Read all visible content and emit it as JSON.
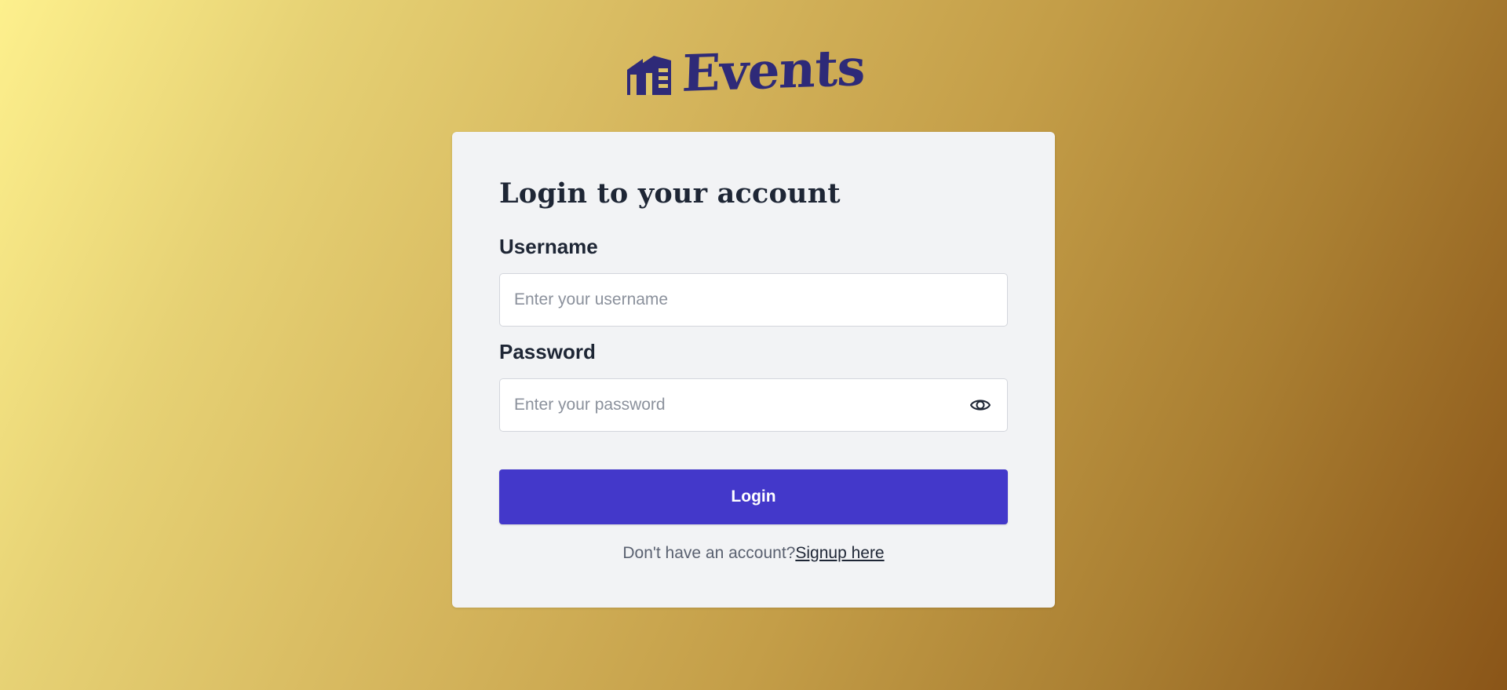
{
  "brand": {
    "name": "Events",
    "icon": "house-icon",
    "color": "#2e2a78"
  },
  "login_form": {
    "title": "Login to your account",
    "username": {
      "label": "Username",
      "placeholder": "Enter your username",
      "value": ""
    },
    "password": {
      "label": "Password",
      "placeholder": "Enter your password",
      "value": "",
      "toggle_icon": "eye-icon"
    },
    "submit_label": "Login",
    "signup_prompt": "Don't have an account?",
    "signup_link": "Signup here"
  },
  "colors": {
    "accent": "#4338ca",
    "card_background": "#f2f3f5",
    "text": "#1e2635"
  }
}
